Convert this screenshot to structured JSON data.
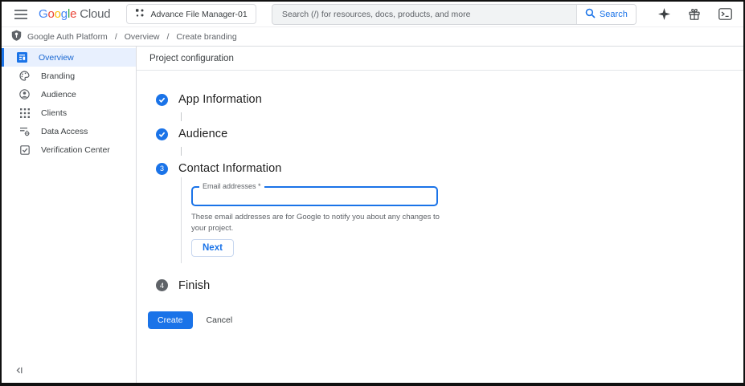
{
  "colors": {
    "accent": "#1a73e8",
    "selected_item_bg": "#e8f0fe",
    "pending_step": "#5f6368",
    "google_blue": "#4285F4",
    "google_red": "#EA4335",
    "google_yellow": "#FBBC04",
    "google_green": "#34A853"
  },
  "topbar": {
    "logo": {
      "letters": [
        "G",
        "o",
        "o",
        "g",
        "l",
        "e"
      ],
      "suffix": "Cloud"
    },
    "project_selector": {
      "label": "Advance File Manager-01"
    },
    "search": {
      "placeholder": "Search (/) for resources, docs, products, and more",
      "button_label": "Search"
    },
    "icons": [
      "gemini-sparkle-icon",
      "gift-icon",
      "cloud-shell-icon"
    ]
  },
  "breadcrumb": {
    "separator": "/",
    "items": [
      "Google Auth Platform",
      "Overview",
      "Create branding"
    ]
  },
  "sidebar": {
    "items": [
      {
        "label": "Overview",
        "icon": "overview-dashboard-icon",
        "selected": true
      },
      {
        "label": "Branding",
        "icon": "branding-palette-icon",
        "selected": false
      },
      {
        "label": "Audience",
        "icon": "audience-person-icon",
        "selected": false
      },
      {
        "label": "Clients",
        "icon": "clients-grid-icon",
        "selected": false
      },
      {
        "label": "Data Access",
        "icon": "data-access-icon",
        "selected": false
      },
      {
        "label": "Verification Center",
        "icon": "verification-center-icon",
        "selected": false
      }
    ]
  },
  "main": {
    "header_title": "Project configuration",
    "steps": [
      {
        "title": "App Information",
        "state": "complete"
      },
      {
        "title": "Audience",
        "state": "complete"
      },
      {
        "title": "Contact Information",
        "number": "3",
        "state": "active",
        "email_label": "Email addresses *",
        "email_value": "",
        "helper_text": "These email addresses are for Google to notify you about any changes to your project.",
        "next_label": "Next"
      },
      {
        "title": "Finish",
        "number": "4",
        "state": "pending"
      }
    ],
    "actions": {
      "create_label": "Create",
      "cancel_label": "Cancel"
    }
  }
}
